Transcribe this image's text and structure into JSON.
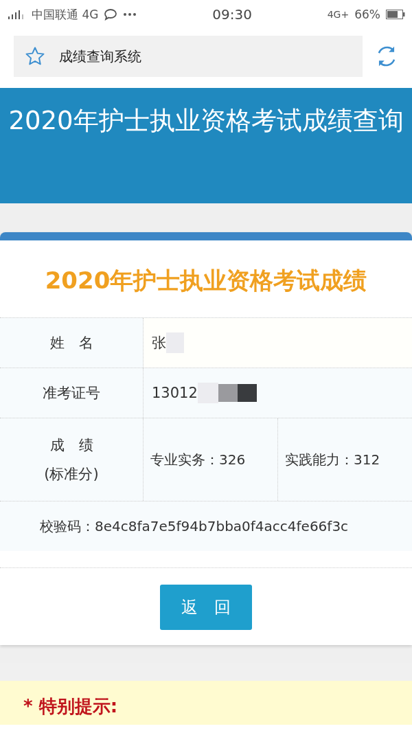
{
  "status_bar": {
    "carrier": "中国联通 4G",
    "time": "09:30",
    "network": "4G+",
    "battery": "66%"
  },
  "browser": {
    "title": "成绩查询系统"
  },
  "header": {
    "title": "2020年护士执业资格考试成绩查询"
  },
  "card": {
    "title": "2020年护士执业资格考试成绩",
    "rows": [
      {
        "kind": "single",
        "label": "姓　名",
        "value": "张",
        "redacted": true
      },
      {
        "kind": "single",
        "label": "准考证号",
        "value": "13012",
        "redacted": true
      },
      {
        "kind": "score",
        "label": "成　绩",
        "sublabel": "(标准分)",
        "scores": [
          "专业实务：326",
          "实践能力：312"
        ]
      },
      {
        "kind": "full",
        "text": "校验码：8e4c8fa7e5f94b7bba0f4acc4fe66f3c"
      }
    ],
    "button": "返　回"
  },
  "notice": {
    "title": "* 特别提示:"
  }
}
